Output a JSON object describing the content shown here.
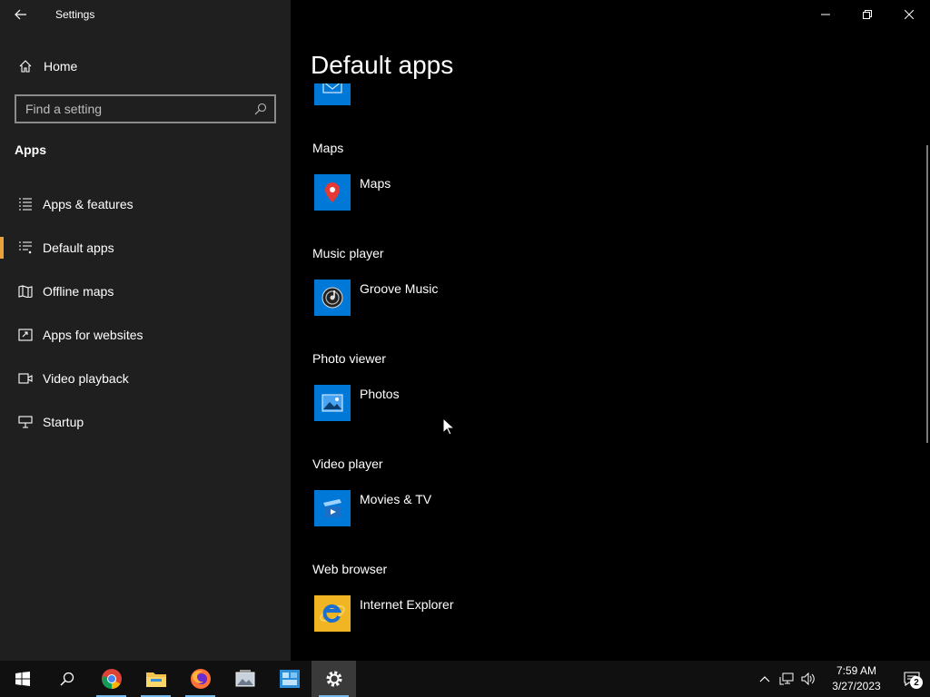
{
  "window": {
    "title": "Settings"
  },
  "sidebar": {
    "home_label": "Home",
    "search_placeholder": "Find a setting",
    "section": "Apps",
    "items": [
      {
        "label": "Apps & features",
        "icon": "list-icon"
      },
      {
        "label": "Default apps",
        "icon": "default-apps-icon",
        "active": true
      },
      {
        "label": "Offline maps",
        "icon": "map-icon"
      },
      {
        "label": "Apps for websites",
        "icon": "open-window-icon"
      },
      {
        "label": "Video playback",
        "icon": "video-icon"
      },
      {
        "label": "Startup",
        "icon": "startup-icon"
      }
    ]
  },
  "main": {
    "title": "Default apps",
    "defaults": [
      {
        "category": "Maps",
        "app": "Maps",
        "icon": "maps-pin-icon"
      },
      {
        "category": "Music player",
        "app": "Groove Music",
        "icon": "groove-music-icon"
      },
      {
        "category": "Photo viewer",
        "app": "Photos",
        "icon": "photos-icon"
      },
      {
        "category": "Video player",
        "app": "Movies & TV",
        "icon": "movies-tv-icon"
      },
      {
        "category": "Web browser",
        "app": "Internet Explorer",
        "icon": "internet-explorer-icon"
      }
    ]
  },
  "taskbar": {
    "apps": [
      "start-icon",
      "search-icon",
      "chrome-icon",
      "file-explorer-icon",
      "firefox-icon",
      "photo-viewer-icon",
      "control-panel-icon",
      "settings-icon"
    ],
    "time": "7:59 AM",
    "date": "3/27/2023",
    "notification_count": "2"
  },
  "colors": {
    "accent": "#0078d7",
    "sidebar_bg": "#1f1f1f",
    "active_indicator": "#e8a33d"
  }
}
